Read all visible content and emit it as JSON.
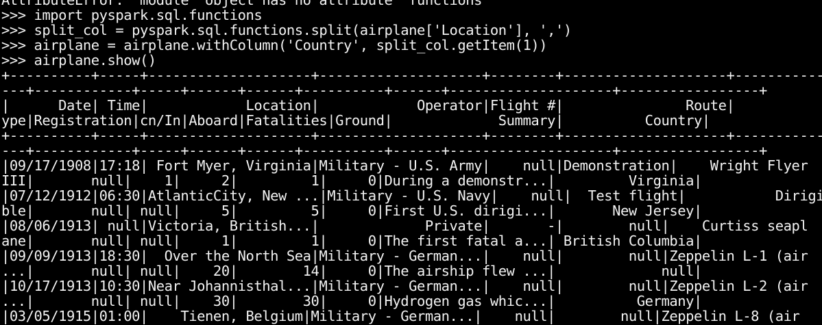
{
  "terminal": {
    "lines": [
      "AttributeError: 'module' object has no attribute 'functions'",
      ">>> import pyspark.sql.functions",
      ">>> split_col = pyspark.sql.functions.split(airplane['Location'], ',')",
      ">>> airplane = airplane.withColumn('Country', split_col.getItem(1))",
      ">>> airplane.show()",
      "+----------+-----+--------------------+--------------------+--------+--------------------+--------------------+---------",
      "---+------------+-----+------+------+----------+------+--------------------+-----------------+",
      "|      Date| Time|            Location|            Operator|Flight #|               Route|                   T",
      "ype|Registration|cn/In|Aboard|Fatalities|Ground|             Summary|          Country|",
      "+----------+-----+--------------------+--------------------+--------+--------------------+--------------------+---------",
      "---+------------+-----+------+------+----------+------+--------------------+-----------------+",
      "|09/17/1908|17:18| Fort Myer, Virginia|Military - U.S. Army|    null|Demonstration|    Wright Flyer",
      "III|       null|    1|     2|         1|     0|During a demonstr...|         Virginia|",
      "|07/12/1912|06:30|AtlanticCity, New ...|Military - U.S. Navy|    null|  Test flight|           Dirigi",
      "ble|       null| null|     5|         5|     0|First U.S. dirigi...|       New Jersey|",
      "|08/06/1913| null|Victoria, British...|             Private|       -|        null|    Curtiss seapl",
      "ane|       null| null|     1|         1|     0|The first fatal a...| British Columbia|",
      "|09/09/1913|18:30|  Over the North Sea|Military - German...|    null|        null|Zeppelin L-1 (air",
      "...|       null| null|    20|        14|     0|The airship flew ...|             null|",
      "|10/17/1913|10:30|Near Johannisthal...|Military - German...|    null|        null|Zeppelin L-2 (air",
      "...|       null| null|    30|        30|     0|Hydrogen gas whic...|          Germany|",
      "|03/05/1915|01:00|    Tienen, Belgium|Military - German...|    null|        null|Zeppelin L-8 (air"
    ]
  }
}
